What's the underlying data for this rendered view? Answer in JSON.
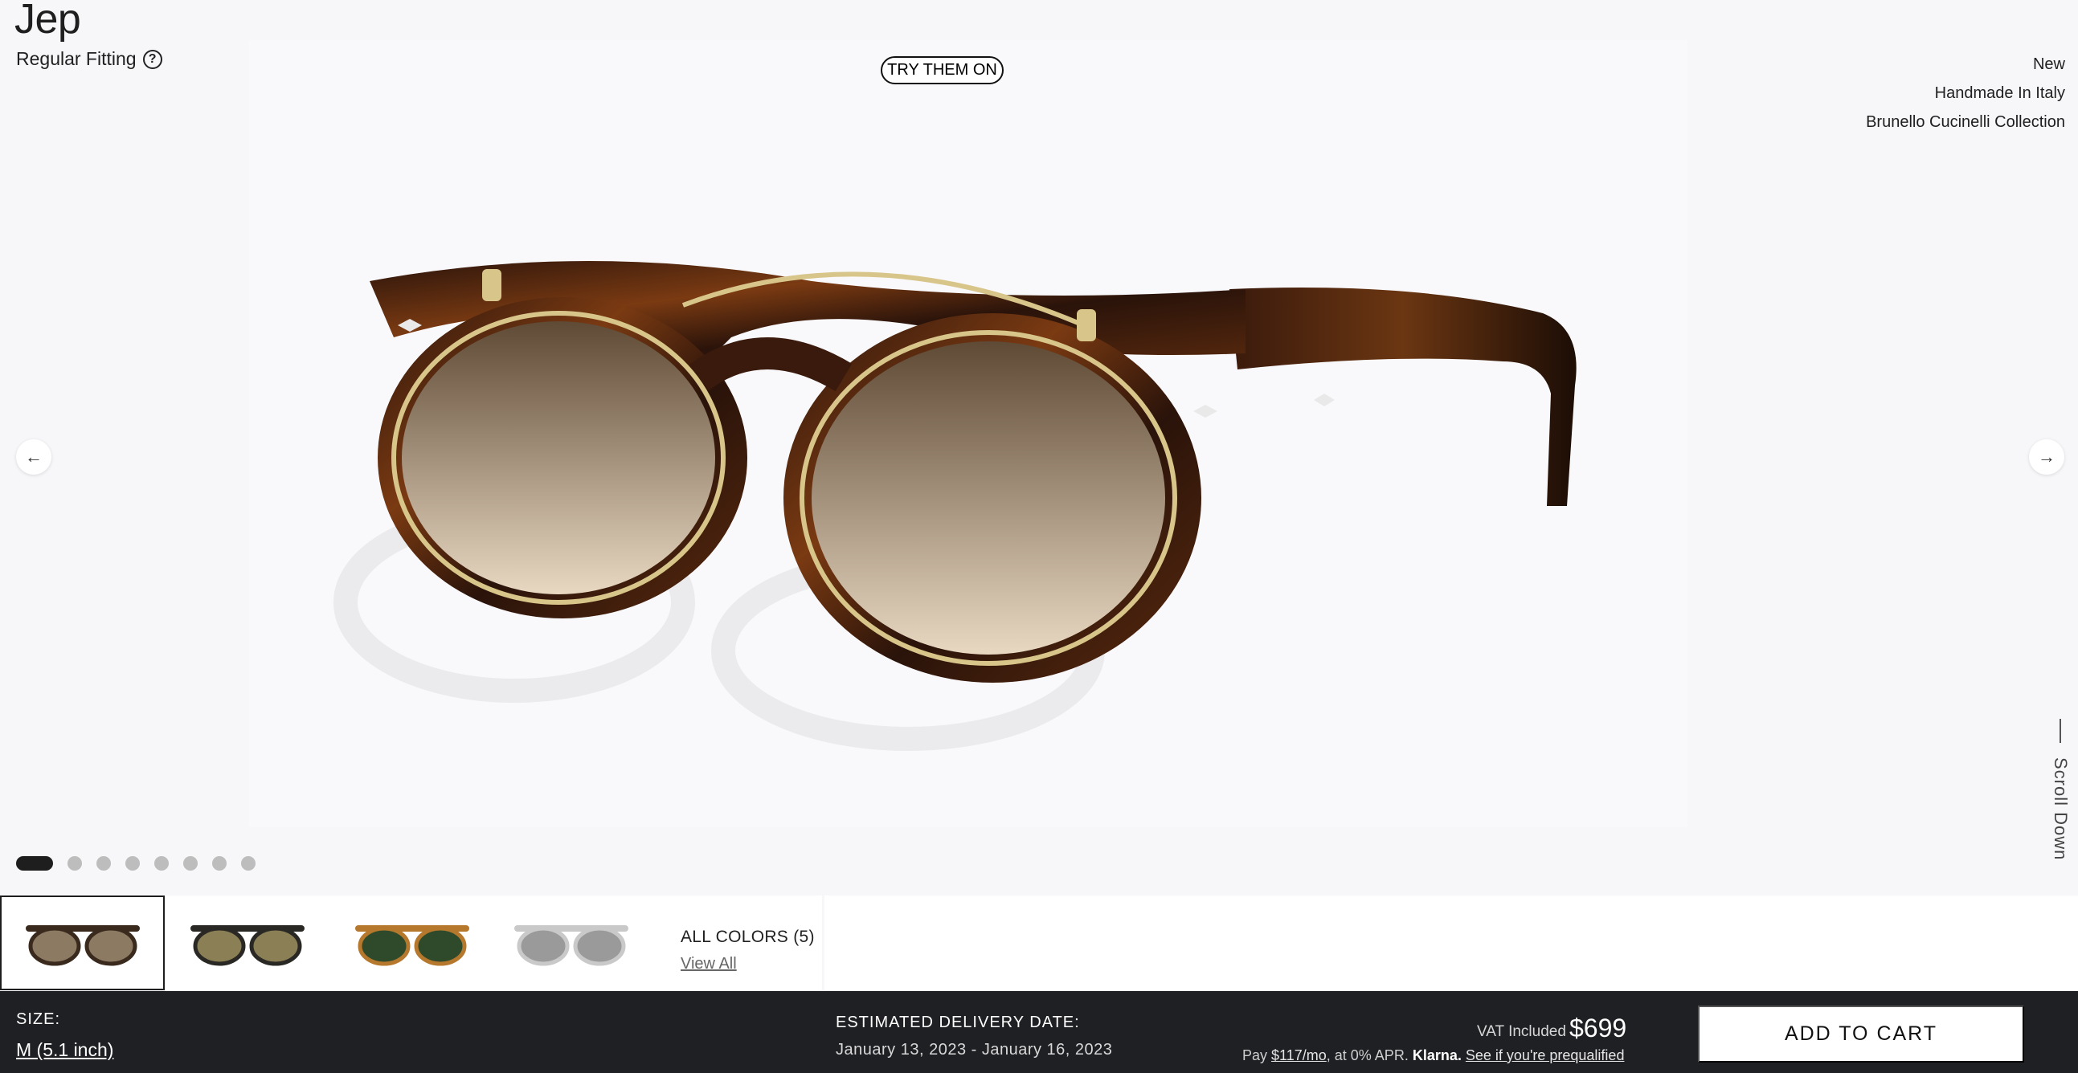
{
  "product": {
    "name": "Jep",
    "fit_label": "Regular Fitting",
    "help_icon_glyph": "?",
    "try_on_label": "TRY THEM ON",
    "tags": [
      "New",
      "Handmade In Italy",
      "Brunello Cucinelli Collection"
    ]
  },
  "gallery": {
    "prev_icon": "←",
    "next_icon": "→",
    "slide_count": 8,
    "active_slide": 1,
    "scroll_hint": "Scroll Down"
  },
  "colors": {
    "all_colors_label": "ALL COLORS (5)",
    "view_all_label": "View All",
    "swatches": [
      {
        "name": "tortoise-brown-gradient",
        "frame": "#3a2a1e",
        "lens": "#8c7a63"
      },
      {
        "name": "black-olive",
        "frame": "#2a2824",
        "lens": "#8b7f55"
      },
      {
        "name": "amber-green",
        "frame": "#b5782d",
        "lens": "#2f4a2a"
      },
      {
        "name": "crystal-grey-gradient",
        "frame": "#c9c9c9",
        "lens": "#7a7a7a"
      }
    ]
  },
  "purchase": {
    "size_label": "SIZE:",
    "size_value": "M (5.1 inch)",
    "delivery_label": "ESTIMATED DELIVERY DATE:",
    "delivery_value": "January 13, 2023 - January 16, 2023",
    "vat_label": "VAT Included",
    "price": "$699",
    "klarna_pay": "Pay",
    "klarna_amount": "$117/mo",
    "klarna_terms": ", at 0% APR.",
    "klarna_brand": "Klarna.",
    "klarna_prequal": "See if you're prequalified",
    "add_to_cart_label": "ADD TO CART"
  }
}
